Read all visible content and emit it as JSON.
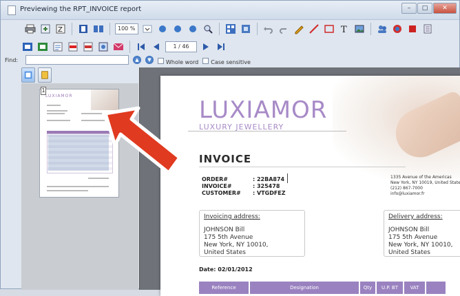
{
  "window": {
    "title": "Previewing the RPT_INVOICE report",
    "minimize": "–",
    "maximize": "□",
    "close": "✕"
  },
  "toolbar": {
    "zoom_value": "100 %",
    "page_value": "1 / 46"
  },
  "find": {
    "label": "Find:",
    "value": "",
    "whole_word_label": "Whole word",
    "case_sensitive_label": "Case sensitive"
  },
  "thumbnail": {
    "page_number": "1",
    "logo": "LUXIAMOR"
  },
  "invoice": {
    "brand": "LUXIAMOR",
    "tagline": "LUXURY JEWELLERY",
    "title": "INVOICE",
    "meta": [
      {
        "key": "ORDER#",
        "value": ": 22BA874"
      },
      {
        "key": "INVOICE#",
        "value": ": 325478"
      },
      {
        "key": "CUSTOMER#",
        "value": ": VTGDFEZ"
      }
    ],
    "company_lines": [
      "1335 Avenue of the Americas",
      "New York, NY 10019, United States",
      "(212) 867-7000",
      "info@luxiamor.fr"
    ],
    "invoicing_address": {
      "title": "Invoicing address:",
      "lines": [
        "JOHNSON Bill",
        "175 5th Avenue",
        "New York, NY 10010,",
        "United States"
      ]
    },
    "delivery_address": {
      "title": "Delivery address:",
      "lines": [
        "JOHNSON Bill",
        "175 5th Avenue",
        "New York, NY 10010,",
        "United States"
      ]
    },
    "date": "Date: 02/01/2012",
    "table_headers": [
      "Reference",
      "Designation",
      "Qty",
      "U.P. BT",
      "VAT"
    ]
  },
  "colors": {
    "brand_purple": "#a78ac7",
    "table_header": "#9a82c0",
    "arrow_red": "#e03a20"
  }
}
